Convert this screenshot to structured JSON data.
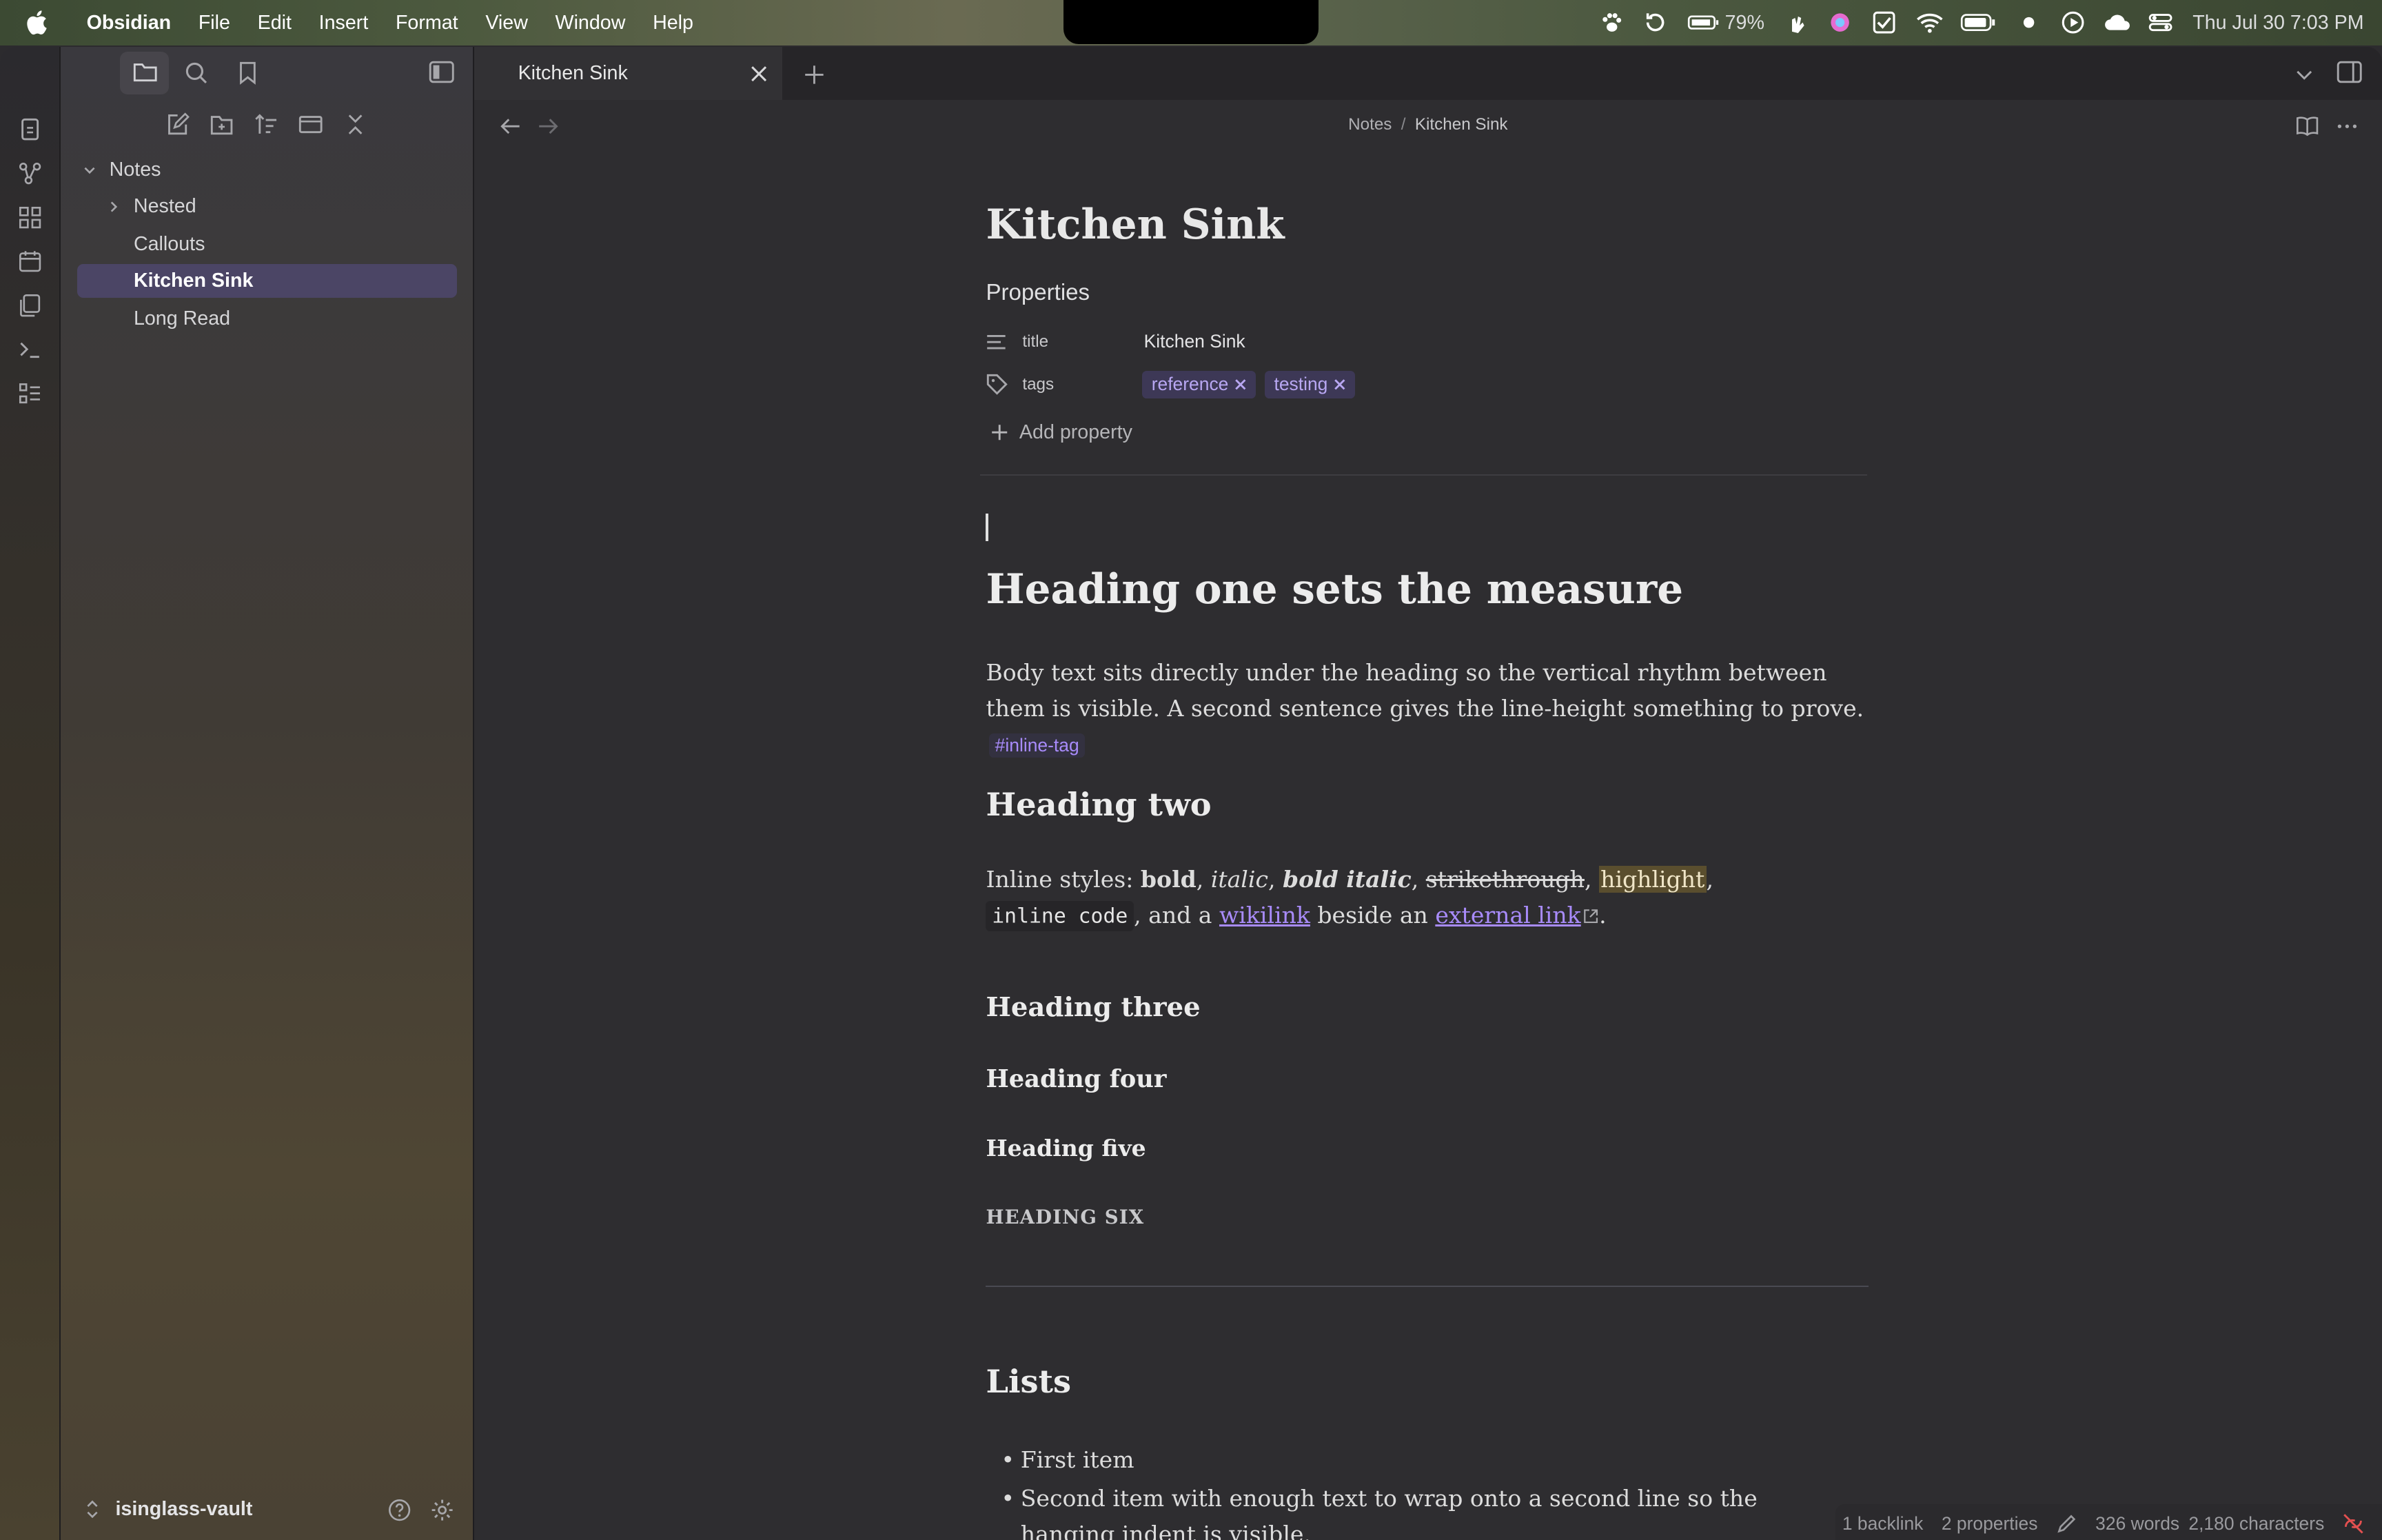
{
  "menubar": {
    "app_name": "Obsidian",
    "menus": [
      "File",
      "Edit",
      "Insert",
      "Format",
      "View",
      "Window",
      "Help"
    ],
    "battery": "79%",
    "clock": "Thu Jul 30  7:03 PM"
  },
  "tab": {
    "title": "Kitchen Sink"
  },
  "sidebar": {
    "root": "Notes",
    "items": [
      "Nested",
      "Callouts",
      "Kitchen Sink",
      "Long Read"
    ],
    "vault": "isinglass-vault"
  },
  "breadcrumb": {
    "folder": "Notes",
    "sep": "/",
    "file": "Kitchen Sink"
  },
  "note": {
    "title": "Kitchen Sink",
    "properties_heading": "Properties",
    "prop_title_key": "title",
    "prop_title_value": "Kitchen Sink",
    "prop_tags_key": "tags",
    "tags": [
      "reference",
      "testing"
    ],
    "add_property": "Add property",
    "h1": "Heading one sets the measure",
    "p1": "Body text sits directly under the heading so the vertical rhythm between them is visible. A second sentence gives the line-height something to prove.",
    "inline_tag": "#inline-tag",
    "h2": "Heading two",
    "inline_prefix": "Inline styles: ",
    "bold": "bold",
    "italic": "italic",
    "bold_italic": "bold italic",
    "strike": "strikethrough",
    "highlight": "highlight",
    "code": "inline code",
    "and_a": ", and a ",
    "wikilink": "wikilink",
    "beside_an": " beside an ",
    "external_link": "external link",
    "h3": "Heading three",
    "h4": "Heading four",
    "h5": "Heading five",
    "h6": "HEADING SIX",
    "lists_heading": "Lists",
    "list": [
      "First item",
      "Second item with enough text to wrap onto a second line so the hanging indent is visible."
    ]
  },
  "status": {
    "backlinks": "1 backlink",
    "properties": "2 properties",
    "words": "326 words",
    "chars": "2,180 characters"
  },
  "colors": {
    "accent": "#a88bfa",
    "tag_bg": "#3d3856",
    "active_item": "#4b4565"
  }
}
